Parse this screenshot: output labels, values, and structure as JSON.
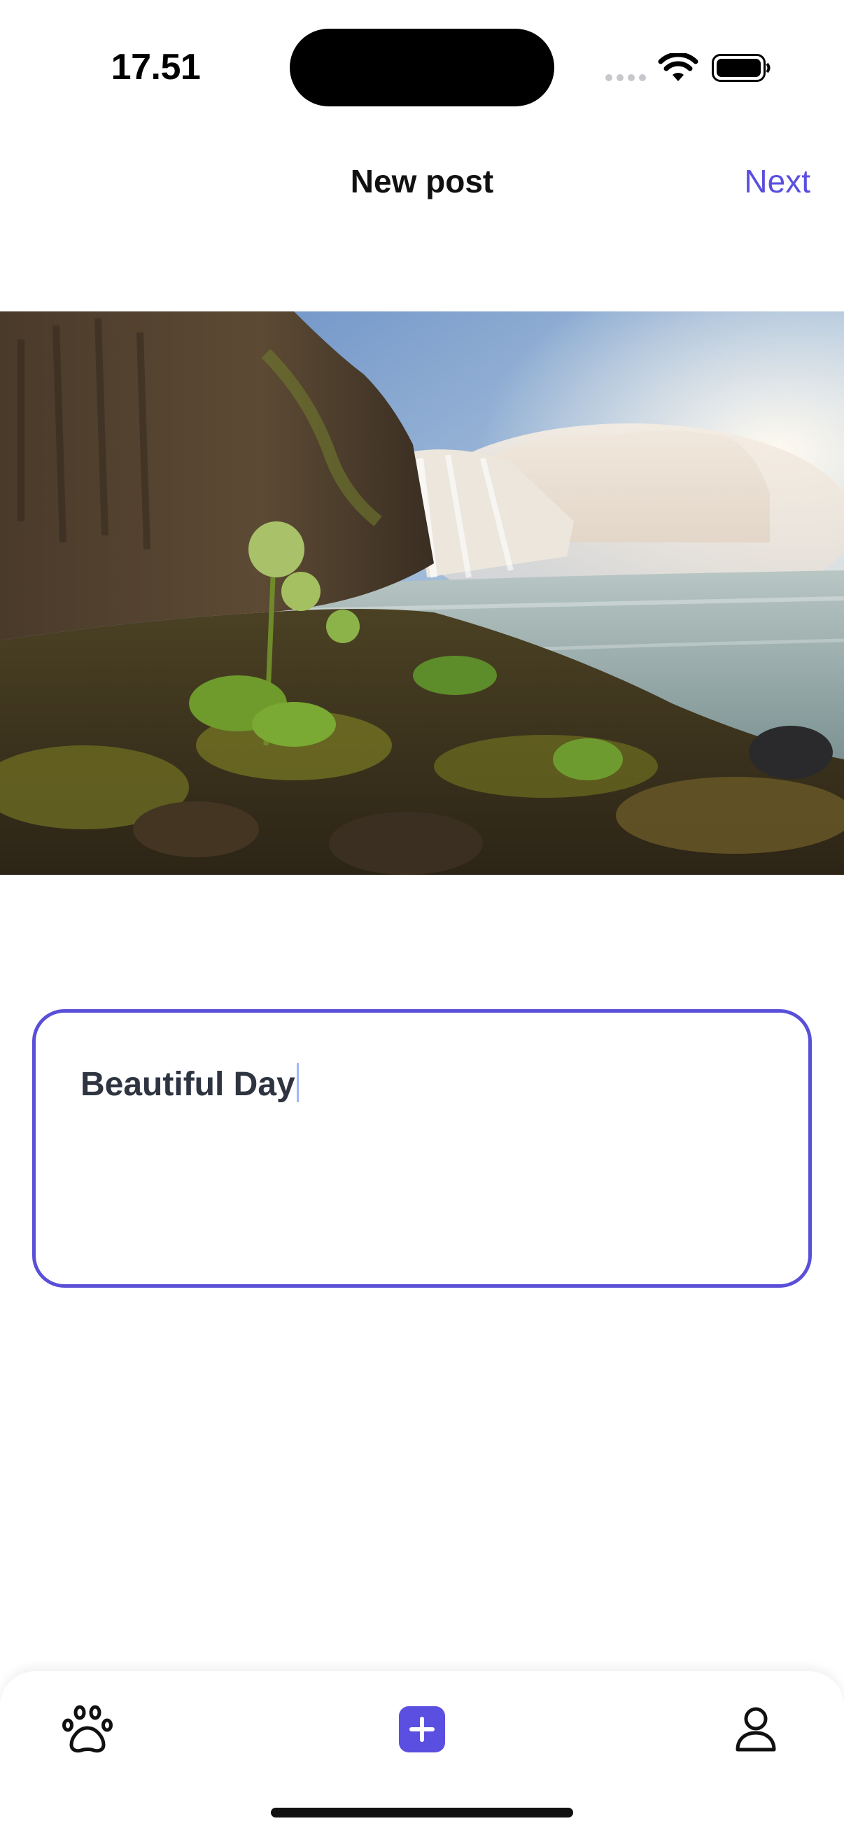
{
  "status_bar": {
    "time": "17.51",
    "icons": [
      "cellular-signal-icon",
      "wifi-icon",
      "battery-icon"
    ]
  },
  "header": {
    "title": "New post",
    "next_label": "Next"
  },
  "photo": {
    "subject": "waterfall-landscape-photo"
  },
  "caption": {
    "value": "Beautiful Day"
  },
  "tab_bar": {
    "tabs": [
      {
        "icon": "paw-icon"
      },
      {
        "icon": "add-post-icon"
      },
      {
        "icon": "profile-icon"
      }
    ]
  },
  "colors": {
    "accent": "#5a4fe0",
    "caption_border": "#5a4fd8",
    "caption_text": "#2e3440"
  }
}
